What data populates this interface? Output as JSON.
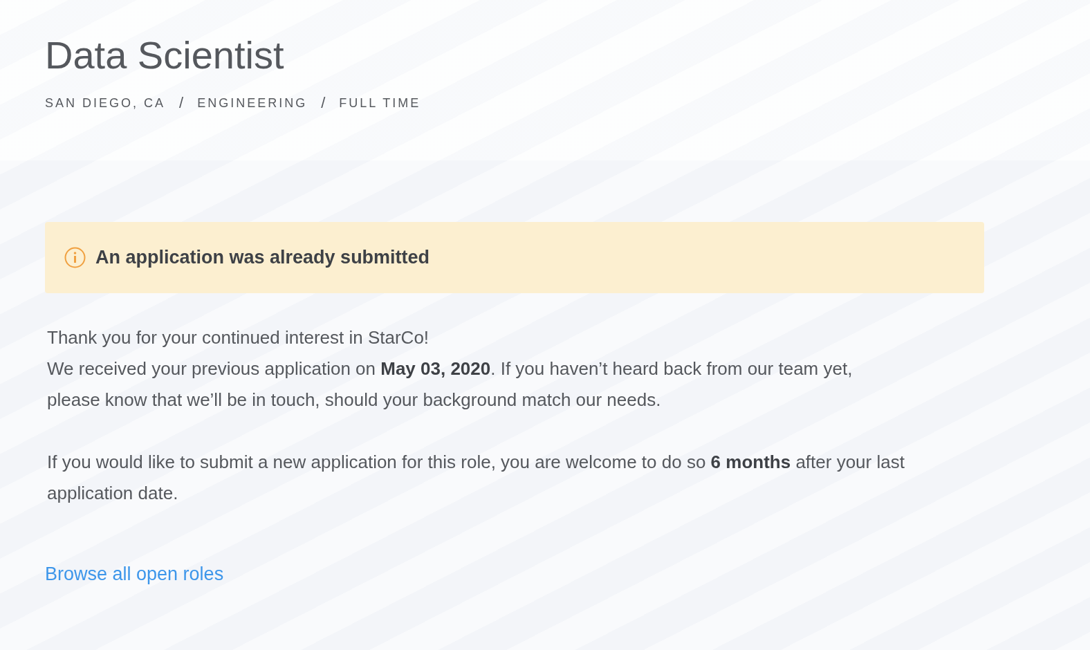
{
  "job": {
    "title": "Data Scientist",
    "meta": [
      "SAN DIEGO, CA",
      "ENGINEERING",
      "FULL TIME"
    ],
    "separator": "/"
  },
  "alert": {
    "kind": "info",
    "title": "An application was already submitted"
  },
  "message": {
    "paragraphs": [
      [
        "Thank you for your continued interest in StarCo!",
        "We received your previous application on **May 03, 2020**. If you haven’t heard back from our team yet,",
        "please know that we’ll be in touch, should your background match our needs."
      ],
      [
        "If you would like to submit a new application for this role, you are welcome to do so **6 months** after your last",
        "application date."
      ]
    ]
  },
  "link": {
    "label": "Browse all open roles"
  }
}
